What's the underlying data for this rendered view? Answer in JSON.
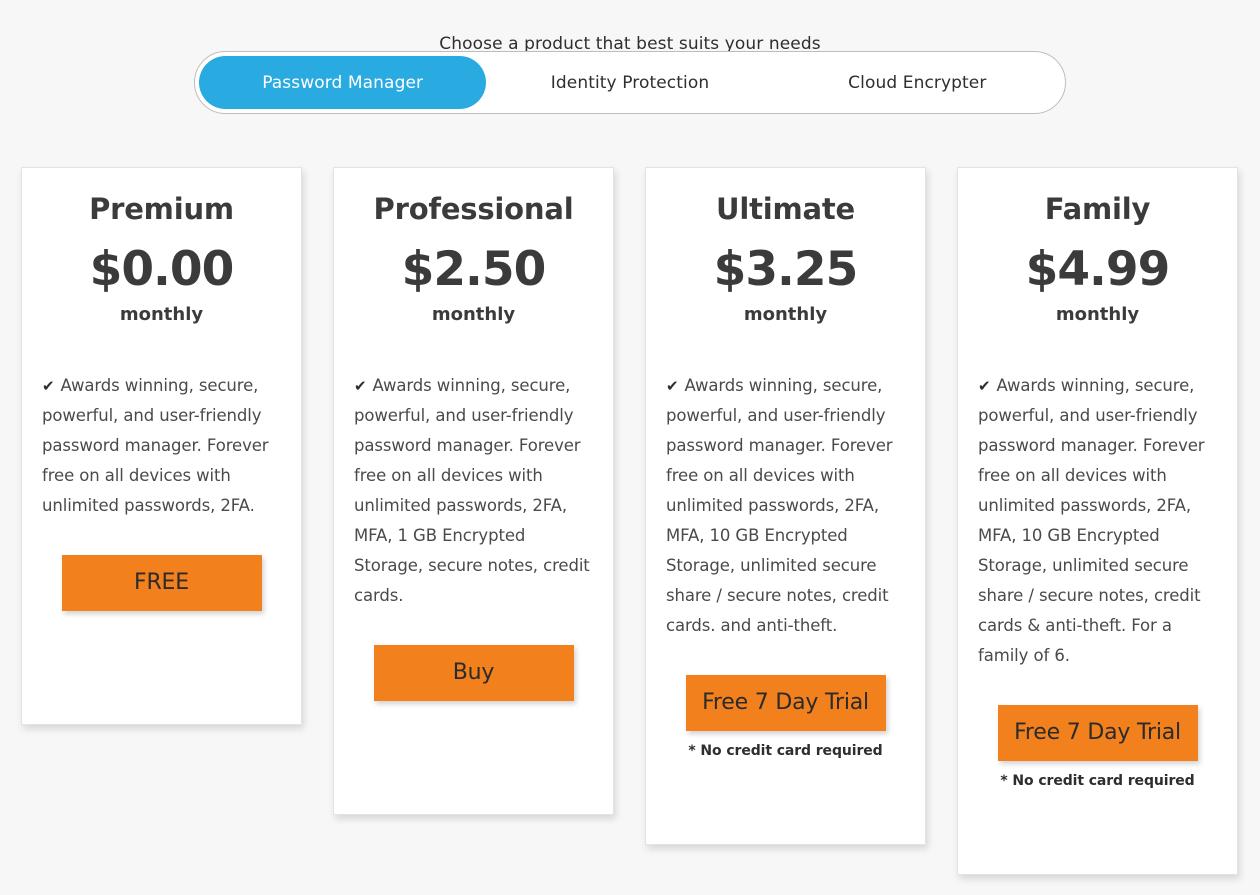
{
  "heading": "Choose a product that best suits your needs",
  "colors": {
    "page_background": "#f7f7f7",
    "accent_blue": "#29abe2",
    "cta_orange": "#f2811d",
    "card_background": "#ffffff",
    "text": "#3b3b3b"
  },
  "switcher": {
    "tabs": [
      {
        "label": "Password Manager",
        "active": true
      },
      {
        "label": "Identity Protection",
        "active": false
      },
      {
        "label": "Cloud Encrypter",
        "active": false
      }
    ]
  },
  "plans": [
    {
      "name": "Premium",
      "price": "$0.00",
      "period": "monthly",
      "check_icon": "check-icon",
      "features": "Awards winning, secure, powerful, and user-friendly password manager. Forever free on all devices with unlimited passwords, 2FA.",
      "cta_label": "FREE",
      "cta_note": ""
    },
    {
      "name": "Professional",
      "price": "$2.50",
      "period": "monthly",
      "check_icon": "check-icon",
      "features": "Awards winning, secure, powerful, and user-friendly password manager. Forever free on all devices with unlimited passwords, 2FA, MFA, 1 GB Encrypted Storage, secure notes, credit cards.",
      "cta_label": "Buy",
      "cta_note": ""
    },
    {
      "name": "Ultimate",
      "price": "$3.25",
      "period": "monthly",
      "check_icon": "check-icon",
      "features": "Awards winning, secure, powerful, and user-friendly password manager. Forever free on all devices with unlimited passwords, 2FA, MFA, 10 GB Encrypted Storage, unlimited secure share / secure notes, credit cards. and anti-theft.",
      "cta_label": "Free 7 Day Trial",
      "cta_note": "* No credit card required"
    },
    {
      "name": "Family",
      "price": "$4.99",
      "period": "monthly",
      "check_icon": "check-icon",
      "features": "Awards winning, secure, powerful, and user-friendly password manager. Forever free on all devices with unlimited passwords, 2FA, MFA, 10 GB Encrypted Storage, unlimited secure share / secure notes, credit cards & anti-theft. For a family of 6.",
      "cta_label": "Free 7 Day Trial",
      "cta_note": "* No credit card required"
    }
  ]
}
